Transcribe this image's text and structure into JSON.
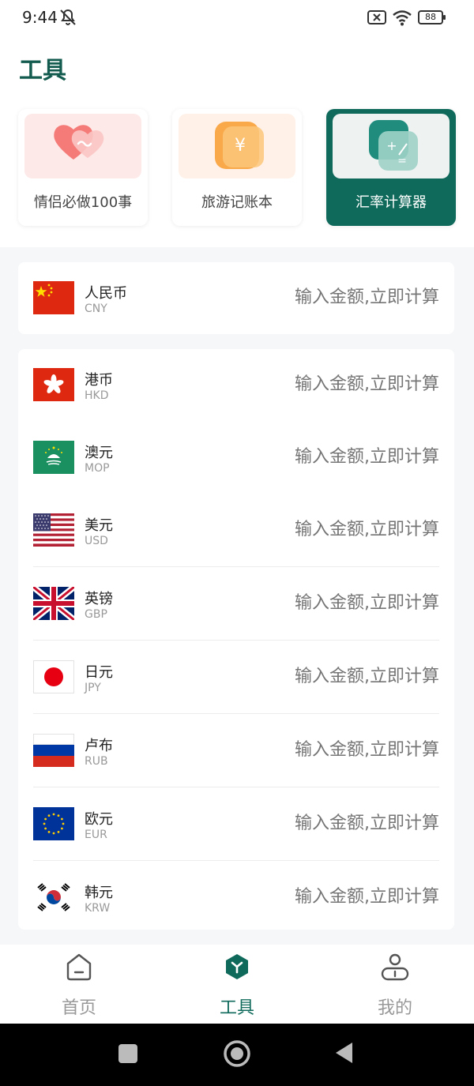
{
  "status": {
    "time": "9:44",
    "battery": "88"
  },
  "page": {
    "title": "工具"
  },
  "tools": [
    {
      "label": "情侣必做100事",
      "icon": "heart-icon"
    },
    {
      "label": "旅游记账本",
      "icon": "yen-wallet-icon"
    },
    {
      "label": "汇率计算器",
      "icon": "calculator-icon",
      "active": true
    }
  ],
  "base_currency": {
    "name": "人民币",
    "code": "CNY",
    "placeholder": "输入金额,立即计算",
    "flag": "china-flag-icon"
  },
  "currencies": [
    {
      "name": "港币",
      "code": "HKD",
      "placeholder": "输入金额,立即计算",
      "flag": "hong-kong-flag-icon"
    },
    {
      "name": "澳元",
      "code": "MOP",
      "placeholder": "输入金额,立即计算",
      "flag": "macau-flag-icon"
    },
    {
      "name": "美元",
      "code": "USD",
      "placeholder": "输入金额,立即计算",
      "flag": "usa-flag-icon"
    },
    {
      "name": "英镑",
      "code": "GBP",
      "placeholder": "输入金额,立即计算",
      "flag": "uk-flag-icon"
    },
    {
      "name": "日元",
      "code": "JPY",
      "placeholder": "输入金额,立即计算",
      "flag": "japan-flag-icon"
    },
    {
      "name": "卢布",
      "code": "RUB",
      "placeholder": "输入金额,立即计算",
      "flag": "russia-flag-icon"
    },
    {
      "name": "欧元",
      "code": "EUR",
      "placeholder": "输入金额,立即计算",
      "flag": "eu-flag-icon"
    },
    {
      "name": "韩元",
      "code": "KRW",
      "placeholder": "输入金额,立即计算",
      "flag": "korea-flag-icon"
    }
  ],
  "tabbar": [
    {
      "label": "首页",
      "icon": "home-icon"
    },
    {
      "label": "工具",
      "icon": "tools-icon",
      "active": true
    },
    {
      "label": "我的",
      "icon": "profile-icon"
    }
  ],
  "colors": {
    "accent": "#0f6a5b",
    "title": "#135b4e",
    "placeholder": "#c5c8cc"
  }
}
